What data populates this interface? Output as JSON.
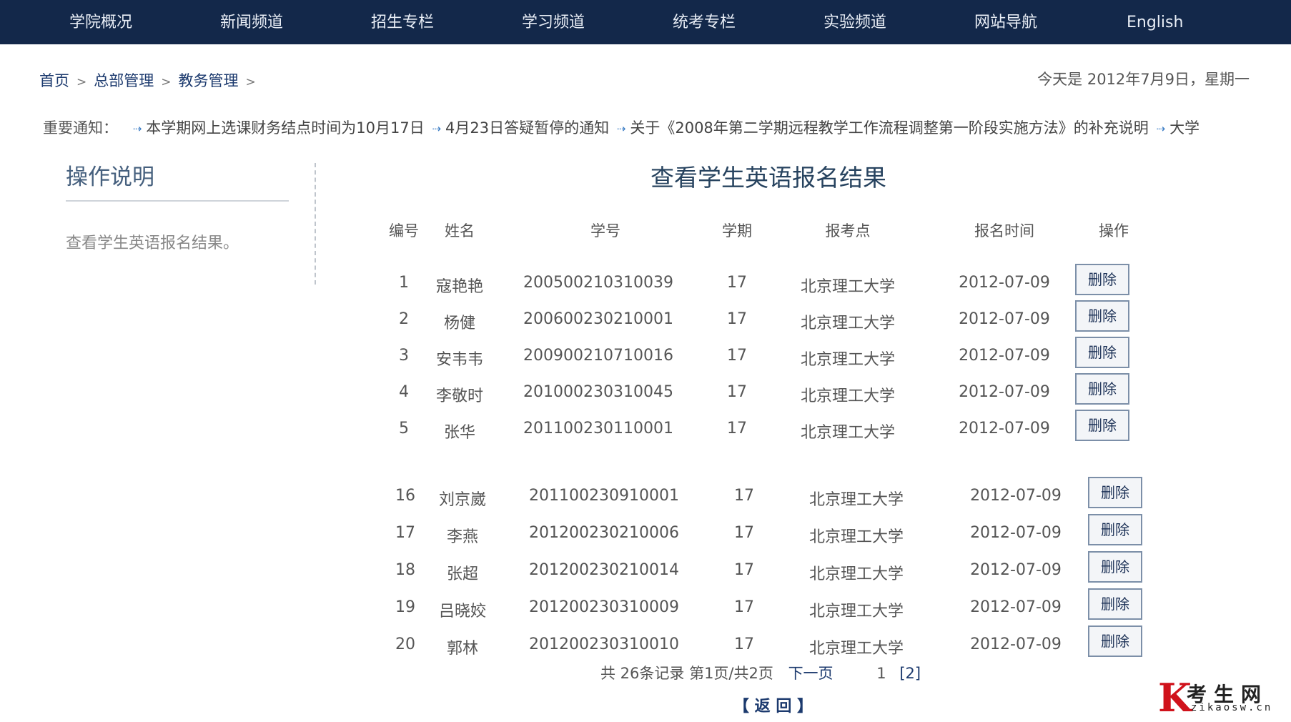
{
  "nav": {
    "items": [
      "学院概况",
      "新闻频道",
      "招生专栏",
      "学习频道",
      "统考专栏",
      "实验频道",
      "网站导航",
      "English"
    ]
  },
  "breadcrumb": {
    "items": [
      "首页",
      "总部管理",
      "教务管理"
    ],
    "separator": ">"
  },
  "date_text": "今天是 2012年7月9日，星期一",
  "notice": {
    "label": "重要通知：",
    "items": [
      "本学期网上选课财务结点时间为10月17日",
      "4月23日答疑暂停的通知",
      "关于《2008年第二学期远程教学工作流程调整第一阶段实施方法》的补充说明",
      "大学"
    ],
    "arrow_glyph": "⇢"
  },
  "sidebar": {
    "title": "操作说明",
    "text": "查看学生英语报名结果。"
  },
  "main": {
    "title": "查看学生英语报名结果"
  },
  "table": {
    "headers": [
      "编号",
      "姓名",
      "学号",
      "学期",
      "报考点",
      "报名时间",
      "操作"
    ],
    "delete_label": "删除",
    "rows_a": [
      [
        "1",
        "寇艳艳",
        "200500210310039",
        "17",
        "北京理工大学",
        "2012-07-09"
      ],
      [
        "2",
        "杨健",
        "200600230210001",
        "17",
        "北京理工大学",
        "2012-07-09"
      ],
      [
        "3",
        "安韦韦",
        "200900210710016",
        "17",
        "北京理工大学",
        "2012-07-09"
      ],
      [
        "4",
        "李敬时",
        "201000230310045",
        "17",
        "北京理工大学",
        "2012-07-09"
      ],
      [
        "5",
        "张华",
        "201100230110001",
        "17",
        "北京理工大学",
        "2012-07-09"
      ]
    ],
    "rows_b": [
      [
        "16",
        "刘京崴",
        "201100230910001",
        "17",
        "北京理工大学",
        "2012-07-09"
      ],
      [
        "17",
        "李燕",
        "201200230210006",
        "17",
        "北京理工大学",
        "2012-07-09"
      ],
      [
        "18",
        "张超",
        "201200230210014",
        "17",
        "北京理工大学",
        "2012-07-09"
      ],
      [
        "19",
        "吕晓姣",
        "201200230310009",
        "17",
        "北京理工大学",
        "2012-07-09"
      ],
      [
        "20",
        "郭林",
        "201200230310010",
        "17",
        "北京理工大学",
        "2012-07-09"
      ]
    ]
  },
  "pager": {
    "summary": "共 26条记录 第1页/共2页",
    "next_label": "下一页",
    "page_current": "1",
    "page_other": "[2]"
  },
  "back_label": "【 返 回 】",
  "watermark": {
    "k": "K",
    "cn": "考生网",
    "en": "zikaosw.cn"
  },
  "colors": {
    "nav_bg": "#13284a",
    "link": "#1c3a6e",
    "watermark_red": "#d0121b"
  }
}
